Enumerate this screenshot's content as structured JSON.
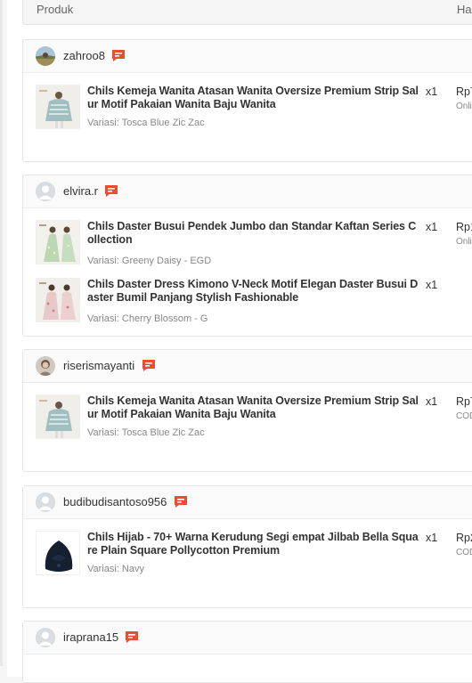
{
  "table_header": {
    "product": "Produk",
    "price": "Harga"
  },
  "orders": [
    {
      "username": "zahroo8",
      "items": [
        {
          "name": "Chils Kemeja Wanita Atasan Wanita Oversize Premium Strip Salur Motif Pakaian Wanita Baju Wanita",
          "variant": "Variasi: Tosca Blue Zic Zac",
          "qty": "x1",
          "price": "Rp7",
          "payment": "Onli"
        }
      ]
    },
    {
      "username": "elvira.r",
      "items": [
        {
          "name": "Chils Daster Busui Pendek Jumbo dan Standar Kaftan Series Collection",
          "variant": "Variasi: Greeny Daisy - EGD",
          "qty": "x1",
          "price": "Rp1",
          "payment": "Onli"
        },
        {
          "name": "Chils Daster Dress Kimono V-Neck Motif Elegan Daster Busui Daster Bumil Panjang Stylish Fashionable",
          "variant": "Variasi: Cherry Blossom - G",
          "qty": "x1",
          "price": "",
          "payment": ""
        }
      ]
    },
    {
      "username": "riserismayanti",
      "items": [
        {
          "name": "Chils Kemeja Wanita Atasan Wanita Oversize Premium Strip Salur Motif Pakaian Wanita Baju Wanita",
          "variant": "Variasi: Tosca Blue Zic Zac",
          "qty": "x1",
          "price": "Rp7",
          "payment": "COD"
        }
      ]
    },
    {
      "username": "budibudisantoso956",
      "items": [
        {
          "name": "Chils Hijab - 70+ Warna Kerudung Segi empat Jilbab Bella Square Plain Square Pollycotton Premium",
          "variant": "Variasi: Navy",
          "qty": "x1",
          "price": "Rp2",
          "payment": "COD"
        }
      ]
    },
    {
      "username": "iraprana15",
      "items": []
    }
  ],
  "colors": {
    "chat_icon": "#ee4d2d",
    "text": "#333333",
    "muted": "#888888"
  },
  "icons": {
    "chat": "chat-bubble-icon",
    "avatar_default": "user-avatar-icon"
  }
}
